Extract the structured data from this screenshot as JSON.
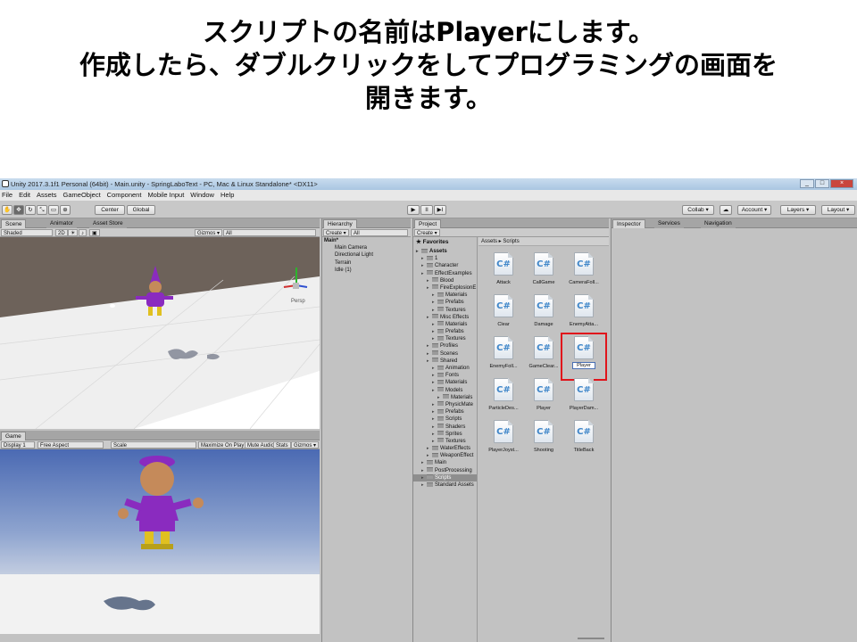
{
  "caption": {
    "line1": "スクリプトの名前はPlayerにします。",
    "line2": "作成したら、ダブルクリックをしてプログラミングの画面を",
    "line3": "開きます。"
  },
  "window": {
    "title": "Unity 2017.3.1f1 Personal (64bit) - Main.unity - SpringLaboText - PC, Mac & Linux Standalone* <DX11>",
    "buttons": [
      "_",
      "□",
      "×"
    ]
  },
  "menu": [
    "File",
    "Edit",
    "Assets",
    "GameObject",
    "Component",
    "Mobile Input",
    "Window",
    "Help"
  ],
  "toolbar": {
    "center": "Center",
    "global": "Global",
    "play": "▶",
    "pause": "II",
    "step": "▶I",
    "collab": "Collab ▾",
    "account": "Account ▾",
    "layers": "Layers ▾",
    "layout": "Layout ▾"
  },
  "scene": {
    "tabs": [
      "Scene",
      "Animator",
      "Asset Store"
    ],
    "shaded": "Shaded",
    "mode_2d": "2D",
    "gizmos": "Gizmos ▾",
    "search": "All",
    "persp": "Persp"
  },
  "game": {
    "tab": "Game",
    "display": "Display 1",
    "aspect": "Free Aspect",
    "scale_label": "Scale",
    "maximize": "Maximize On Play",
    "mute": "Mute Audio",
    "stats": "Stats",
    "gizmos": "Gizmos ▾"
  },
  "hierarchy": {
    "tab": "Hierarchy",
    "create": "Create ▾",
    "search": "All",
    "items": [
      {
        "label": "Main*",
        "indent": 0
      },
      {
        "label": "Main Camera",
        "indent": 1
      },
      {
        "label": "Directional Light",
        "indent": 1
      },
      {
        "label": "Terrain",
        "indent": 1
      },
      {
        "label": "Idle (1)",
        "indent": 1
      }
    ]
  },
  "project": {
    "tab": "Project",
    "create": "Create ▾",
    "favorites": "Favorites",
    "breadcrumb": "Assets ▸ Scripts",
    "tree": [
      {
        "label": "Assets",
        "indent": 0
      },
      {
        "label": "1",
        "indent": 1
      },
      {
        "label": "Character",
        "indent": 1
      },
      {
        "label": "EffectExamples",
        "indent": 1
      },
      {
        "label": "Blood",
        "indent": 2
      },
      {
        "label": "FireExplosionE",
        "indent": 2
      },
      {
        "label": "Materials",
        "indent": 3
      },
      {
        "label": "Prefabs",
        "indent": 3
      },
      {
        "label": "Textures",
        "indent": 3
      },
      {
        "label": "Misc Effects",
        "indent": 2
      },
      {
        "label": "Materials",
        "indent": 3
      },
      {
        "label": "Prefabs",
        "indent": 3
      },
      {
        "label": "Textures",
        "indent": 3
      },
      {
        "label": "Profiles",
        "indent": 2
      },
      {
        "label": "Scenes",
        "indent": 2
      },
      {
        "label": "Shared",
        "indent": 2
      },
      {
        "label": "Animation",
        "indent": 3
      },
      {
        "label": "Fonts",
        "indent": 3
      },
      {
        "label": "Materials",
        "indent": 3
      },
      {
        "label": "Models",
        "indent": 3
      },
      {
        "label": "Materials",
        "indent": 4
      },
      {
        "label": "PhysicMate",
        "indent": 3
      },
      {
        "label": "Prefabs",
        "indent": 3
      },
      {
        "label": "Scripts",
        "indent": 3
      },
      {
        "label": "Shaders",
        "indent": 3
      },
      {
        "label": "Sprites",
        "indent": 3
      },
      {
        "label": "Textures",
        "indent": 3
      },
      {
        "label": "WaterEffects",
        "indent": 2
      },
      {
        "label": "WeaponEffect",
        "indent": 2
      },
      {
        "label": "Main",
        "indent": 1
      },
      {
        "label": "PostProcessing",
        "indent": 1
      },
      {
        "label": "Scripts",
        "indent": 1
      },
      {
        "label": "Standard Assets",
        "indent": 1
      }
    ],
    "assets": [
      "Attack",
      "CallGame",
      "CameraFoll...",
      "Clear",
      "Damage",
      "EnemyAtta...",
      "EnemyFoll...",
      "GameClear...",
      "Player",
      "ParticleDes...",
      "Player",
      "PlayerDam...",
      "PlayerJoyst...",
      "Shooting",
      "TitleBack"
    ],
    "icon_text": "C#"
  },
  "inspector": {
    "tabs": [
      "Inspector",
      "Services",
      "Navigation"
    ]
  },
  "colors": {
    "highlight": "#e0141b",
    "csharp": "#3f86c9"
  }
}
